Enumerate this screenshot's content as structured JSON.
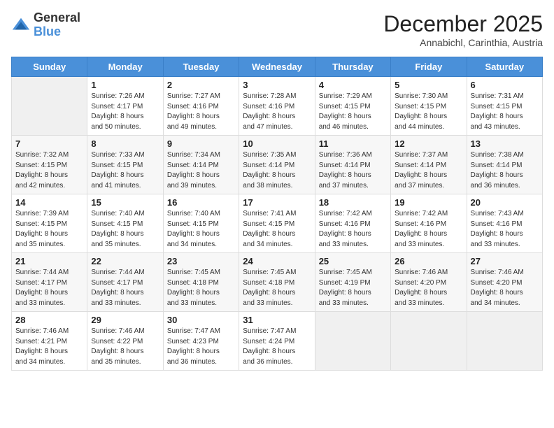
{
  "logo": {
    "general": "General",
    "blue": "Blue"
  },
  "title": {
    "month": "December 2025",
    "location": "Annabichl, Carinthia, Austria"
  },
  "days_of_week": [
    "Sunday",
    "Monday",
    "Tuesday",
    "Wednesday",
    "Thursday",
    "Friday",
    "Saturday"
  ],
  "weeks": [
    [
      {
        "day": "",
        "sunrise": "",
        "sunset": "",
        "daylight": ""
      },
      {
        "day": "1",
        "sunrise": "Sunrise: 7:26 AM",
        "sunset": "Sunset: 4:17 PM",
        "daylight": "Daylight: 8 hours and 50 minutes."
      },
      {
        "day": "2",
        "sunrise": "Sunrise: 7:27 AM",
        "sunset": "Sunset: 4:16 PM",
        "daylight": "Daylight: 8 hours and 49 minutes."
      },
      {
        "day": "3",
        "sunrise": "Sunrise: 7:28 AM",
        "sunset": "Sunset: 4:16 PM",
        "daylight": "Daylight: 8 hours and 47 minutes."
      },
      {
        "day": "4",
        "sunrise": "Sunrise: 7:29 AM",
        "sunset": "Sunset: 4:15 PM",
        "daylight": "Daylight: 8 hours and 46 minutes."
      },
      {
        "day": "5",
        "sunrise": "Sunrise: 7:30 AM",
        "sunset": "Sunset: 4:15 PM",
        "daylight": "Daylight: 8 hours and 44 minutes."
      },
      {
        "day": "6",
        "sunrise": "Sunrise: 7:31 AM",
        "sunset": "Sunset: 4:15 PM",
        "daylight": "Daylight: 8 hours and 43 minutes."
      }
    ],
    [
      {
        "day": "7",
        "sunrise": "Sunrise: 7:32 AM",
        "sunset": "Sunset: 4:15 PM",
        "daylight": "Daylight: 8 hours and 42 minutes."
      },
      {
        "day": "8",
        "sunrise": "Sunrise: 7:33 AM",
        "sunset": "Sunset: 4:15 PM",
        "daylight": "Daylight: 8 hours and 41 minutes."
      },
      {
        "day": "9",
        "sunrise": "Sunrise: 7:34 AM",
        "sunset": "Sunset: 4:14 PM",
        "daylight": "Daylight: 8 hours and 39 minutes."
      },
      {
        "day": "10",
        "sunrise": "Sunrise: 7:35 AM",
        "sunset": "Sunset: 4:14 PM",
        "daylight": "Daylight: 8 hours and 38 minutes."
      },
      {
        "day": "11",
        "sunrise": "Sunrise: 7:36 AM",
        "sunset": "Sunset: 4:14 PM",
        "daylight": "Daylight: 8 hours and 37 minutes."
      },
      {
        "day": "12",
        "sunrise": "Sunrise: 7:37 AM",
        "sunset": "Sunset: 4:14 PM",
        "daylight": "Daylight: 8 hours and 37 minutes."
      },
      {
        "day": "13",
        "sunrise": "Sunrise: 7:38 AM",
        "sunset": "Sunset: 4:14 PM",
        "daylight": "Daylight: 8 hours and 36 minutes."
      }
    ],
    [
      {
        "day": "14",
        "sunrise": "Sunrise: 7:39 AM",
        "sunset": "Sunset: 4:15 PM",
        "daylight": "Daylight: 8 hours and 35 minutes."
      },
      {
        "day": "15",
        "sunrise": "Sunrise: 7:40 AM",
        "sunset": "Sunset: 4:15 PM",
        "daylight": "Daylight: 8 hours and 35 minutes."
      },
      {
        "day": "16",
        "sunrise": "Sunrise: 7:40 AM",
        "sunset": "Sunset: 4:15 PM",
        "daylight": "Daylight: 8 hours and 34 minutes."
      },
      {
        "day": "17",
        "sunrise": "Sunrise: 7:41 AM",
        "sunset": "Sunset: 4:15 PM",
        "daylight": "Daylight: 8 hours and 34 minutes."
      },
      {
        "day": "18",
        "sunrise": "Sunrise: 7:42 AM",
        "sunset": "Sunset: 4:16 PM",
        "daylight": "Daylight: 8 hours and 33 minutes."
      },
      {
        "day": "19",
        "sunrise": "Sunrise: 7:42 AM",
        "sunset": "Sunset: 4:16 PM",
        "daylight": "Daylight: 8 hours and 33 minutes."
      },
      {
        "day": "20",
        "sunrise": "Sunrise: 7:43 AM",
        "sunset": "Sunset: 4:16 PM",
        "daylight": "Daylight: 8 hours and 33 minutes."
      }
    ],
    [
      {
        "day": "21",
        "sunrise": "Sunrise: 7:44 AM",
        "sunset": "Sunset: 4:17 PM",
        "daylight": "Daylight: 8 hours and 33 minutes."
      },
      {
        "day": "22",
        "sunrise": "Sunrise: 7:44 AM",
        "sunset": "Sunset: 4:17 PM",
        "daylight": "Daylight: 8 hours and 33 minutes."
      },
      {
        "day": "23",
        "sunrise": "Sunrise: 7:45 AM",
        "sunset": "Sunset: 4:18 PM",
        "daylight": "Daylight: 8 hours and 33 minutes."
      },
      {
        "day": "24",
        "sunrise": "Sunrise: 7:45 AM",
        "sunset": "Sunset: 4:18 PM",
        "daylight": "Daylight: 8 hours and 33 minutes."
      },
      {
        "day": "25",
        "sunrise": "Sunrise: 7:45 AM",
        "sunset": "Sunset: 4:19 PM",
        "daylight": "Daylight: 8 hours and 33 minutes."
      },
      {
        "day": "26",
        "sunrise": "Sunrise: 7:46 AM",
        "sunset": "Sunset: 4:20 PM",
        "daylight": "Daylight: 8 hours and 33 minutes."
      },
      {
        "day": "27",
        "sunrise": "Sunrise: 7:46 AM",
        "sunset": "Sunset: 4:20 PM",
        "daylight": "Daylight: 8 hours and 34 minutes."
      }
    ],
    [
      {
        "day": "28",
        "sunrise": "Sunrise: 7:46 AM",
        "sunset": "Sunset: 4:21 PM",
        "daylight": "Daylight: 8 hours and 34 minutes."
      },
      {
        "day": "29",
        "sunrise": "Sunrise: 7:46 AM",
        "sunset": "Sunset: 4:22 PM",
        "daylight": "Daylight: 8 hours and 35 minutes."
      },
      {
        "day": "30",
        "sunrise": "Sunrise: 7:47 AM",
        "sunset": "Sunset: 4:23 PM",
        "daylight": "Daylight: 8 hours and 36 minutes."
      },
      {
        "day": "31",
        "sunrise": "Sunrise: 7:47 AM",
        "sunset": "Sunset: 4:24 PM",
        "daylight": "Daylight: 8 hours and 36 minutes."
      },
      {
        "day": "",
        "sunrise": "",
        "sunset": "",
        "daylight": ""
      },
      {
        "day": "",
        "sunrise": "",
        "sunset": "",
        "daylight": ""
      },
      {
        "day": "",
        "sunrise": "",
        "sunset": "",
        "daylight": ""
      }
    ]
  ]
}
